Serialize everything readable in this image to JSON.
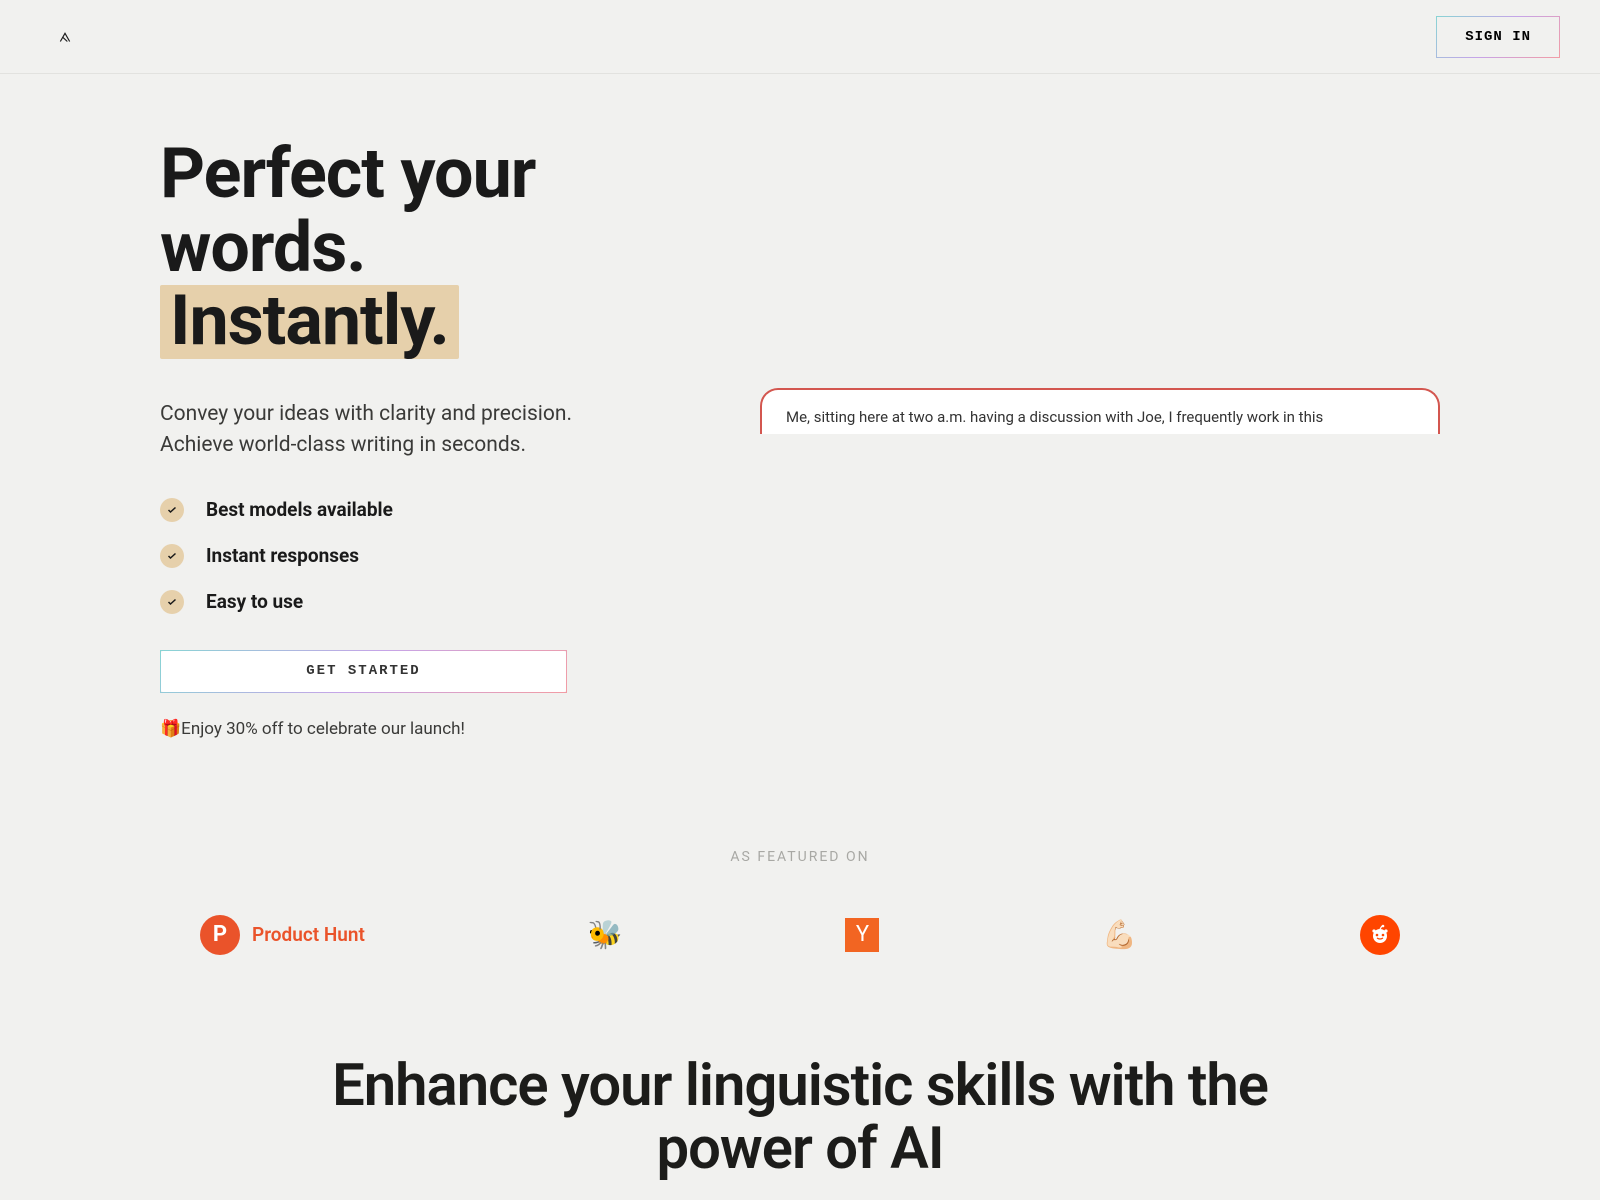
{
  "header": {
    "sign_in_label": "SIGN IN"
  },
  "hero": {
    "title_line1": "Perfect your words.",
    "title_highlight": "Instantly.",
    "subtitle": "Convey your ideas with clarity and precision. Achieve world-class writing in seconds.",
    "features": [
      "Best models available",
      "Instant responses",
      "Easy to use"
    ],
    "cta_label": "GET STARTED",
    "promo": "🎁Enjoy 30% off to celebrate our launch!",
    "preview_text": "Me, sitting here at two a.m. having a discussion with Joe, I frequently work in this"
  },
  "featured": {
    "label": "AS FEATURED ON",
    "items": {
      "product_hunt": "Product Hunt",
      "yc": "Y",
      "ph_p": "P"
    }
  },
  "section2": {
    "heading": "Enhance your linguistic skills with the power of AI"
  }
}
